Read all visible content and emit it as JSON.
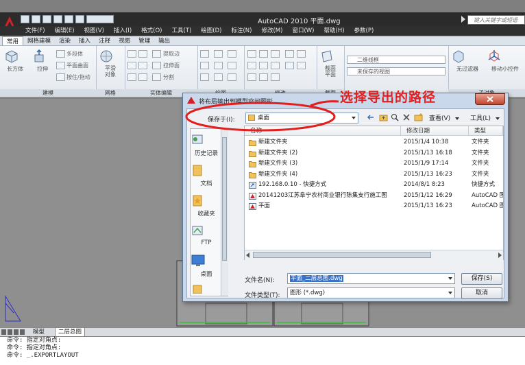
{
  "app": {
    "title": "AutoCAD 2010    平面.dwg",
    "search_placeholder": "键入关键字或短语"
  },
  "menu": [
    "文件(F)",
    "编辑(E)",
    "视图(V)",
    "插入(I)",
    "格式(O)",
    "工具(T)",
    "绘图(D)",
    "标注(N)",
    "修改(M)",
    "窗口(W)",
    "帮助(H)",
    "参数(P)"
  ],
  "ribbon_tabs": [
    "常用",
    "网格建模",
    "渲染",
    "插入",
    "注释",
    "视图",
    "管理",
    "输出"
  ],
  "ribbon": {
    "box_label": "长方体",
    "extrude_label": "拉伸",
    "polysolid_label": "多段体",
    "planar_label": "平面曲面",
    "sweep_label": "按住/拖动",
    "smooth_label": "平滑\n对象",
    "extract_edges_label": "提取边",
    "extrude_face_label": "拉伸面",
    "separate_label": "分割",
    "section_label": "截面\n平面",
    "visual_style_value": "二维线框",
    "view_value": "未保存的视图",
    "no_filter_label": "无过滤器",
    "gizmo_label": "移动小控件",
    "panels": [
      "建模",
      "网格",
      "实体编辑",
      "绘图",
      "修改",
      "截面",
      "子对象"
    ]
  },
  "layout_tabs": [
    "模型",
    "二层总图"
  ],
  "command_lines": [
    "命令: 指定对角点:",
    "命令: 指定对角点:",
    "命令: _.EXPORTLAYOUT"
  ],
  "dialog": {
    "title": "将布局输出到模型空间图形",
    "save_in_label": "保存于(I):",
    "save_in_value": "桌面",
    "views_label": "查看(V)",
    "tools_label": "工具(L)",
    "places": [
      "历史记录",
      "文档",
      "收藏夹",
      "FTP",
      "桌面"
    ],
    "columns": [
      "名称",
      "修改日期",
      "类型"
    ],
    "files": [
      {
        "name": "新建文件夹",
        "date": "2015/1/4 10:38",
        "type": "文件夹",
        "icon": "folder"
      },
      {
        "name": "新建文件夹 (2)",
        "date": "2015/1/13 16:18",
        "type": "文件夹",
        "icon": "folder"
      },
      {
        "name": "新建文件夹 (3)",
        "date": "2015/1/9 17:14",
        "type": "文件夹",
        "icon": "folder"
      },
      {
        "name": "新建文件夹 (4)",
        "date": "2015/1/13 16:23",
        "type": "文件夹",
        "icon": "folder"
      },
      {
        "name": "192.168.0.10 - 快捷方式",
        "date": "2014/8/1 8:23",
        "type": "快捷方式",
        "icon": "shortcut"
      },
      {
        "name": "20141203江苏阜宁农村商业银行陈集支行施工图",
        "date": "2015/1/12 16:29",
        "type": "AutoCAD 图",
        "icon": "dwg"
      },
      {
        "name": "平面",
        "date": "2015/1/13 16:23",
        "type": "AutoCAD 图",
        "icon": "dwg"
      }
    ],
    "filename_label": "文件名(N):",
    "filename_value": "平面_二层总图.dwg",
    "filetype_label": "文件类型(T):",
    "filetype_value": "图形 (*.dwg)",
    "save_button": "保存(S)",
    "cancel_button": "取消"
  },
  "annotation": "选择导出的路径",
  "colors": {
    "annotation": "#e21e1e",
    "dialog_frame": "#c9d8ea",
    "title_bar": "#2b2b2b",
    "selection": "#3a72c8"
  }
}
